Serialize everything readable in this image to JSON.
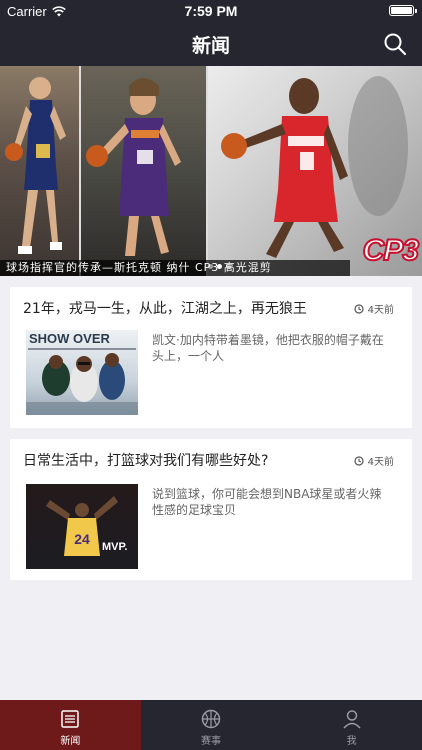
{
  "status_bar": {
    "carrier": "Carrier",
    "time": "7:59 PM"
  },
  "nav": {
    "title": "新闻",
    "search_icon": "search-icon"
  },
  "banner": {
    "caption": "球场指挥官的传承—斯托克顿  纳什  CP3 高光混剪",
    "badge_text": "CP3",
    "page_count": 3,
    "active_page": 1,
    "jersey_numbers": [
      "12",
      "13",
      "3"
    ],
    "jersey_teams": [
      "JAZZ",
      "PHOENIX",
      "Los Angeles"
    ]
  },
  "articles": [
    {
      "title": "21年，戎马一生，从此，江湖之上，再无狼王",
      "time": "4天前",
      "time_icon": "clock-icon",
      "desc": "凯文·加内特带着墨镜，他把衣服的帽子戴在头上，一个人",
      "thumb_text": "SHOW OVER"
    },
    {
      "title": "日常生活中，打篮球对我们有哪些好处?",
      "time": "4天前",
      "time_icon": "clock-icon",
      "desc": "说到篮球，你可能会想到NBA球星或者火辣性感的足球宝贝",
      "thumb_text": "MVP.",
      "thumb_number": "24"
    }
  ],
  "tabs": [
    {
      "label": "新闻",
      "icon": "news-icon",
      "active": true
    },
    {
      "label": "赛事",
      "icon": "basketball-icon",
      "active": false
    },
    {
      "label": "我",
      "icon": "person-icon",
      "active": false
    }
  ],
  "colors": {
    "bar_bg": "#262631",
    "active_tab": "#6e1a1a",
    "page_bg": "#efeff4"
  }
}
